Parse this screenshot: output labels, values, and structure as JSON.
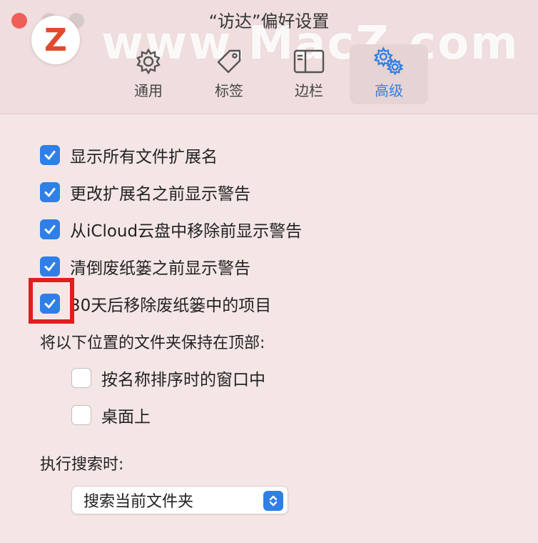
{
  "window": {
    "title": "“访达”偏好设置",
    "watermark": "www.MacZ.com",
    "logo_letter": "Z"
  },
  "tabs": [
    {
      "label": "通用",
      "icon": "gear-icon",
      "active": false
    },
    {
      "label": "标签",
      "icon": "tag-icon",
      "active": false
    },
    {
      "label": "边栏",
      "icon": "sidebar-icon",
      "active": false
    },
    {
      "label": "高级",
      "icon": "gears-icon",
      "active": true
    }
  ],
  "options": [
    {
      "label": "显示所有文件扩展名",
      "checked": true
    },
    {
      "label": "更改扩展名之前显示警告",
      "checked": true
    },
    {
      "label": "从iCloud云盘中移除前显示警告",
      "checked": true
    },
    {
      "label": "清倒废纸篓之前显示警告",
      "checked": true
    },
    {
      "label": "30天后移除废纸篓中的项目",
      "checked": true
    }
  ],
  "keep_folders": {
    "heading": "将以下位置的文件夹保持在顶部:",
    "items": [
      {
        "label": "按名称排序时的窗口中",
        "checked": false
      },
      {
        "label": "桌面上",
        "checked": false
      }
    ]
  },
  "search": {
    "heading": "执行搜索时:",
    "selected": "搜索当前文件夹"
  },
  "colors": {
    "accent": "#2f7fe6",
    "highlight": "#e01e1e"
  }
}
